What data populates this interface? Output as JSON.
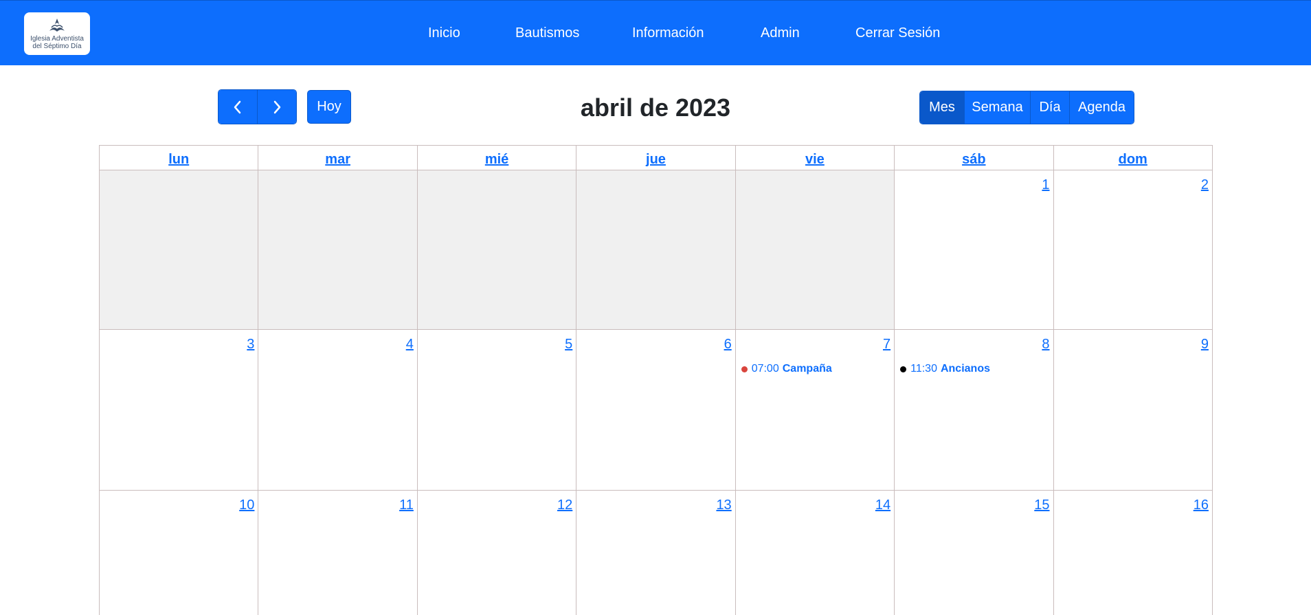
{
  "logo": {
    "line1": "Iglesia Adventista",
    "line2": "del Séptimo Día"
  },
  "nav": [
    {
      "label": "Inicio"
    },
    {
      "label": "Bautismos"
    },
    {
      "label": "Información"
    },
    {
      "label": "Admin"
    },
    {
      "label": "Cerrar Sesión"
    }
  ],
  "toolbar": {
    "prev_icon": "chevron-left-icon",
    "next_icon": "chevron-right-icon",
    "today_label": "Hoy",
    "title": "abril de 2023",
    "views": [
      {
        "label": "Mes",
        "active": true
      },
      {
        "label": "Semana",
        "active": false
      },
      {
        "label": "Día",
        "active": false
      },
      {
        "label": "Agenda",
        "active": false
      }
    ]
  },
  "calendar": {
    "weekdays": [
      "lun",
      "mar",
      "mié",
      "jue",
      "vie",
      "sáb",
      "dom"
    ],
    "weeks": [
      [
        "",
        "",
        "",
        "",
        "",
        "1",
        "2"
      ],
      [
        "3",
        "4",
        "5",
        "6",
        "7",
        "8",
        "9"
      ],
      [
        "10",
        "11",
        "12",
        "13",
        "14",
        "15",
        "16"
      ]
    ],
    "events": [
      {
        "day": "7",
        "time": "07:00",
        "title": "Campaña",
        "dot_color": "#d9453d"
      },
      {
        "day": "8",
        "time": "11:30",
        "title": "Ancianos",
        "dot_color": "#000000"
      }
    ]
  },
  "colors": {
    "brand": "#0d6efd",
    "brand_dark": "#0a58ca",
    "off_day_bg": "#f0f0f0",
    "grid_line": "#c9bcbc"
  }
}
